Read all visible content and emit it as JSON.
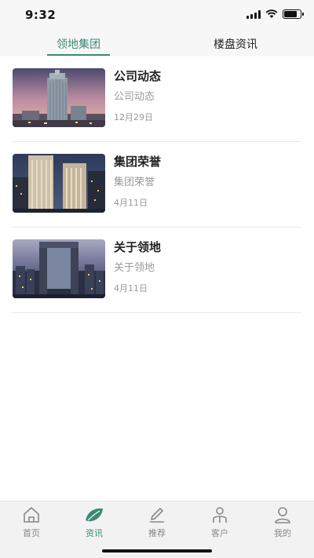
{
  "status_bar": {
    "time": "9:32",
    "battery_level": 0.85
  },
  "tabs": [
    {
      "label": "领地集团",
      "active": true
    },
    {
      "label": "楼盘资讯",
      "active": false
    }
  ],
  "news": [
    {
      "title": "公司动态",
      "subtitle": "公司动态",
      "date": "12月29日",
      "image": "tower-dusk-photo"
    },
    {
      "title": "集团荣誉",
      "subtitle": "集团荣誉",
      "date": "4月11日",
      "image": "twin-towers-night-photo"
    },
    {
      "title": "关于领地",
      "subtitle": "关于领地",
      "date": "4月11日",
      "image": "gate-building-night-photo"
    }
  ],
  "bottom_nav": [
    {
      "label": "首页",
      "icon": "home-icon",
      "active": false
    },
    {
      "label": "资讯",
      "icon": "leaf-icon",
      "active": true
    },
    {
      "label": "推荐",
      "icon": "pen-icon",
      "active": false
    },
    {
      "label": "客户",
      "icon": "customer-icon",
      "active": false
    },
    {
      "label": "我的",
      "icon": "profile-icon",
      "active": false
    }
  ],
  "colors": {
    "accent": "#3b8a74",
    "text": "#222222",
    "muted": "#999999",
    "divider": "#e8e8e8"
  }
}
